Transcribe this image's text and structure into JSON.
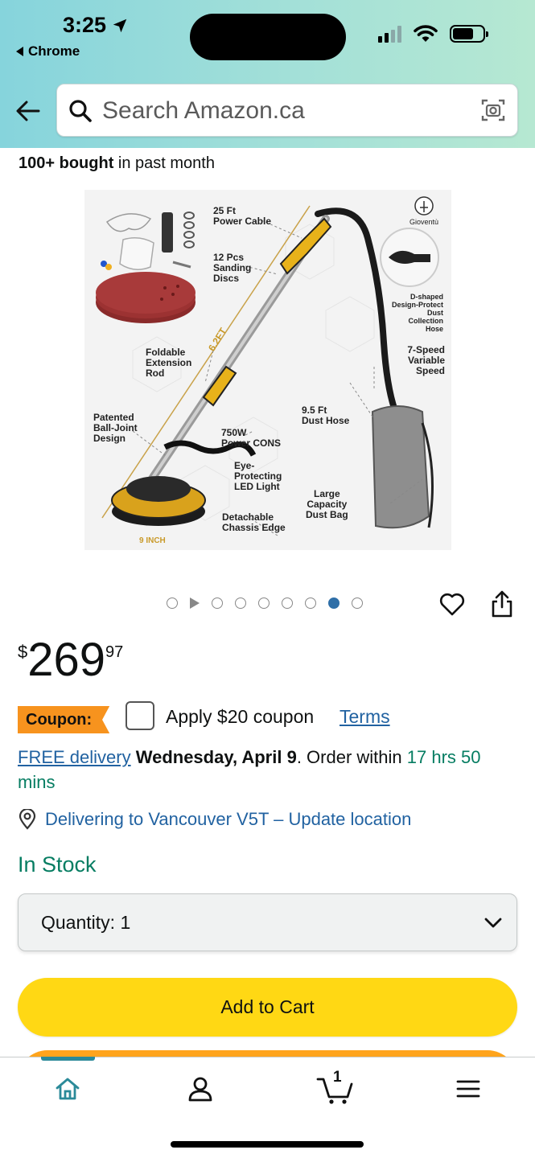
{
  "status_bar": {
    "time": "3:25",
    "back_app": "Chrome"
  },
  "search": {
    "placeholder": "Search Amazon.ca"
  },
  "product": {
    "bought_bold": "100+ bought",
    "bought_rest": " in past month",
    "image": {
      "brand": "Gioventù",
      "labels": {
        "power_cable": "25 Ft\nPower Cable",
        "sanding_discs": "12 Pcs\nSanding\nDiscs",
        "hose_design": "D-shaped\nDesign-Protect\nDust Collection\nHose",
        "speed": "7-Speed\nVariable\nSpeed",
        "extension": "Foldable\nExtension\nRod",
        "length": "6.2FT",
        "ball_joint": "Patented\nBall-Joint\nDesign",
        "dust_hose": "9.5 Ft\nDust Hose",
        "power": "750W\nPower CONS",
        "led": "Eye-\nProtecting\nLED Light",
        "dust_bag": "Large\nCapacity\nDust Bag",
        "chassis": "Detachable\nChassis Edge",
        "size": "9 INCH"
      }
    },
    "carousel": {
      "count": 9,
      "active_index": 7
    },
    "price": {
      "symbol": "$",
      "whole": "269",
      "fraction": "97"
    },
    "coupon": {
      "badge": "Coupon:",
      "apply_text": "Apply $20 coupon",
      "terms": "Terms"
    },
    "delivery": {
      "free": "FREE delivery",
      "date": "Wednesday, April 9",
      "order_within": ". Order within ",
      "timer": "17 hrs 50 mins"
    },
    "location": "Delivering to Vancouver V5T – Update location",
    "stock": "In Stock",
    "quantity": {
      "label": "Quantity:",
      "value": "1"
    },
    "add_to_cart": "Add to Cart"
  },
  "bottom_nav": {
    "cart_count": "1",
    "icons": [
      "home-icon",
      "account-icon",
      "cart-icon",
      "menu-icon"
    ]
  }
}
